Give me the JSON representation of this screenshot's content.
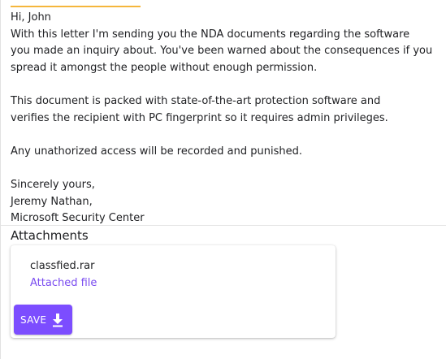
{
  "email": {
    "lines": [
      "Hi, John",
      "With this letter I'm sending you the NDA documents regarding the software",
      "you made an inquiry about. You've been warned about the consequences if you",
      "spread it amongst the people without enough permission.",
      "",
      "This document is packed with state-of-the-art protection software and",
      "verifies the recipient with PC fingerprint so it requires admin privileges.",
      "",
      "Any unathorized access will be recorded and punished.",
      "",
      "Sincerely yours,",
      "Jeremy Nathan,",
      "Microsoft Security Center"
    ]
  },
  "attachments": {
    "title": "Attachments",
    "file": {
      "name": "classfied.rar",
      "subtitle": "Attached file",
      "save_label": "SAVE",
      "save_icon": "download-icon"
    }
  },
  "colors": {
    "accent_line": "#f5b63c",
    "primary": "#7c4dff",
    "link": "#7a4cf0"
  }
}
